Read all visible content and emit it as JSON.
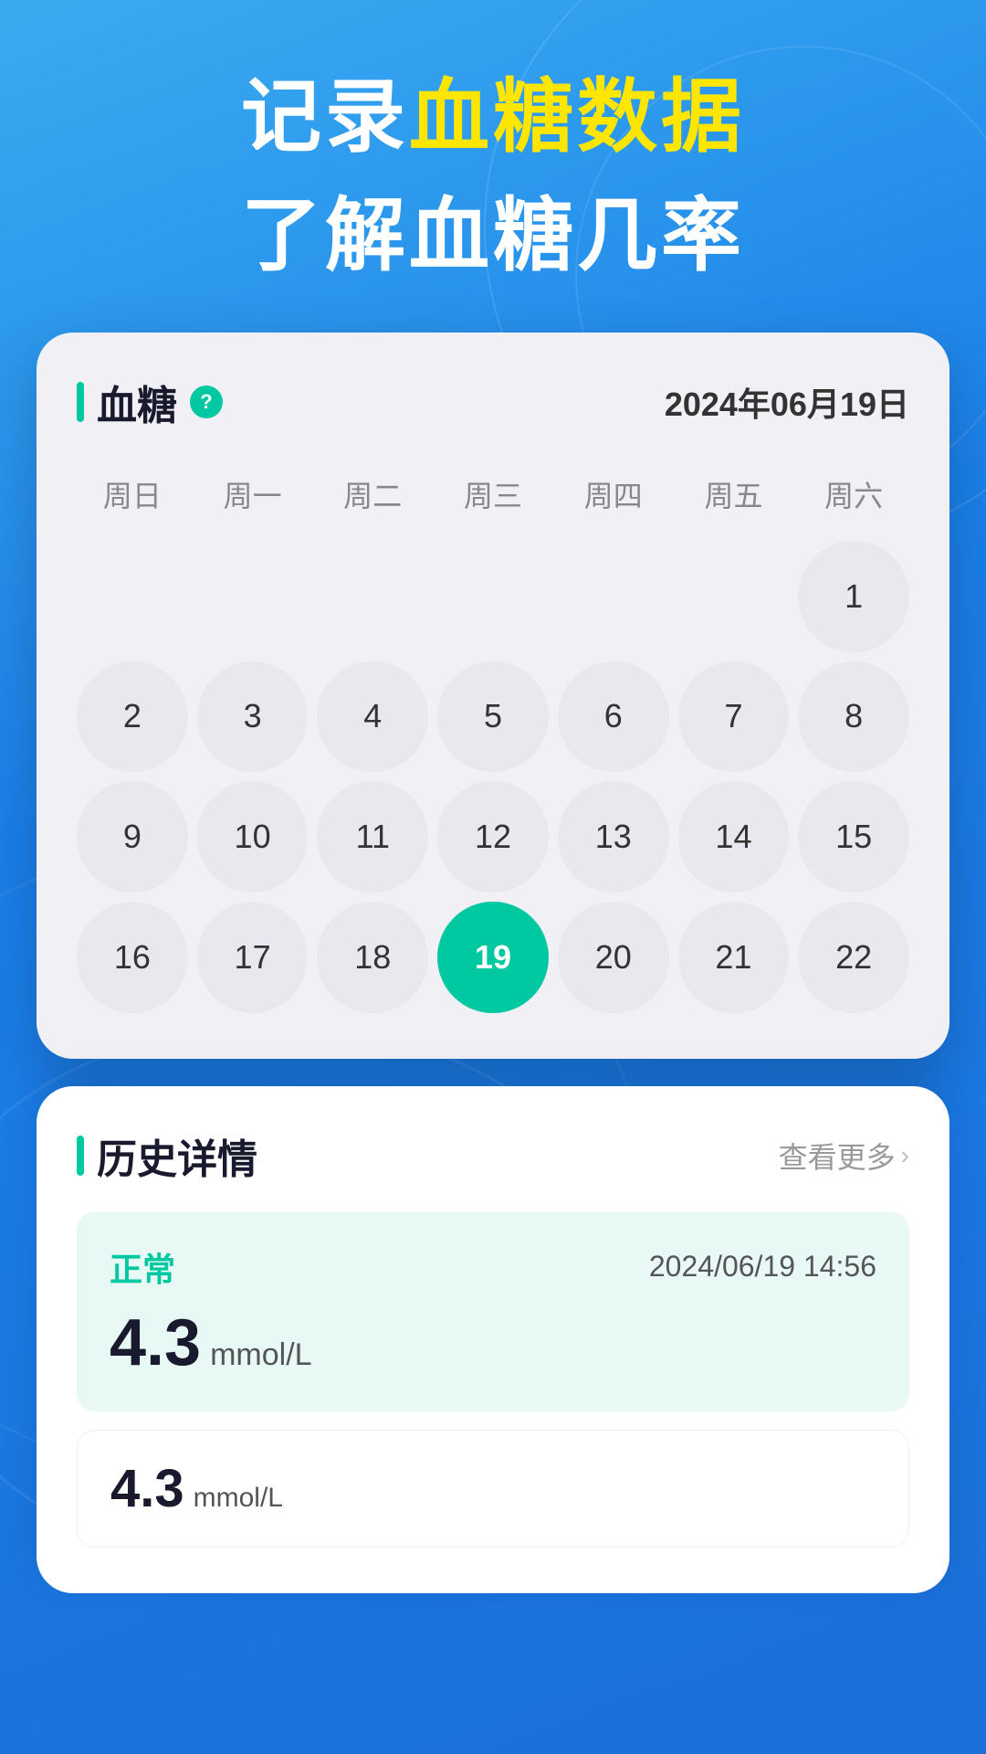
{
  "hero": {
    "line1_prefix": "记录",
    "line1_accent": "血糖数据",
    "line2": "了解血糖几率"
  },
  "calendar": {
    "title": "血糖",
    "date": "2024年06月19日",
    "help_icon": "?",
    "week_headers": [
      "周日",
      "周一",
      "周二",
      "周三",
      "周四",
      "周五",
      "周六"
    ],
    "days": [
      {
        "n": "",
        "empty": true
      },
      {
        "n": "",
        "empty": true
      },
      {
        "n": "",
        "empty": true
      },
      {
        "n": "",
        "empty": true
      },
      {
        "n": "",
        "empty": true
      },
      {
        "n": "",
        "empty": true
      },
      {
        "n": "1"
      },
      {
        "n": "2"
      },
      {
        "n": "3"
      },
      {
        "n": "4"
      },
      {
        "n": "5"
      },
      {
        "n": "6"
      },
      {
        "n": "7"
      },
      {
        "n": "8"
      },
      {
        "n": "9"
      },
      {
        "n": "10"
      },
      {
        "n": "11"
      },
      {
        "n": "12"
      },
      {
        "n": "13"
      },
      {
        "n": "14"
      },
      {
        "n": "15"
      },
      {
        "n": "16"
      },
      {
        "n": "17"
      },
      {
        "n": "18"
      },
      {
        "n": "19",
        "active": true
      },
      {
        "n": "20"
      },
      {
        "n": "21"
      },
      {
        "n": "22"
      }
    ]
  },
  "history": {
    "title": "历史详情",
    "view_more": "查看更多",
    "records": [
      {
        "status": "正常",
        "time": "2024/06/19 14:56",
        "value": "4.3",
        "unit": "mmol/L"
      },
      {
        "value": "4.3",
        "unit": "mmol/L"
      }
    ]
  }
}
